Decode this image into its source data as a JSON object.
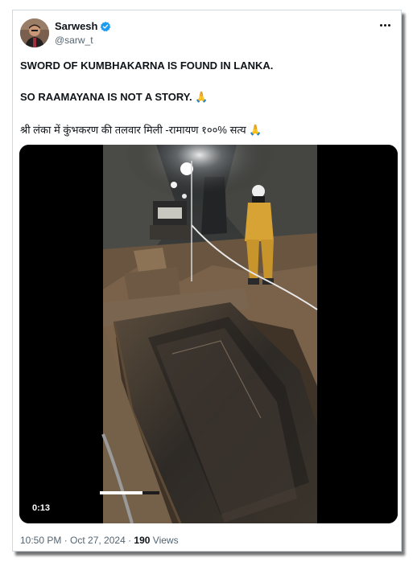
{
  "author": {
    "name": "Sarwesh",
    "handle": "@sarw_t",
    "verified_color": "#1d9bf0"
  },
  "tweet": {
    "line1": "SWORD OF KUMBHAKARNA IS FOUND IN LANKA.",
    "line2": "SO RAAMAYANA IS NOT A STORY.",
    "line3": "श्री लंका में कुंभकरण की तलवार मिली -रामायण १००% सत्य",
    "emoji": "🙏"
  },
  "video": {
    "timecode": "0:13",
    "progress": 0.72
  },
  "meta": {
    "timestamp": "10:50 PM · Oct 27, 2024 ·",
    "views_count": "190",
    "views_label": "Views"
  }
}
